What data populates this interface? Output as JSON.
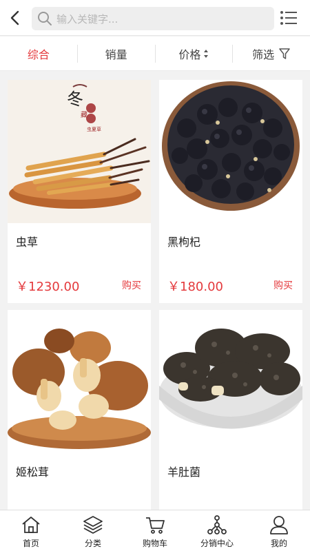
{
  "header": {
    "search_placeholder": "输入关键字..."
  },
  "sort_tabs": [
    {
      "label": "综合",
      "active": true
    },
    {
      "label": "销量",
      "active": false
    },
    {
      "label": "价格",
      "active": false
    },
    {
      "label": "筛选",
      "active": false
    }
  ],
  "products": [
    {
      "name": "虫草",
      "price": "￥1230.00",
      "buy_label": "购买",
      "image_text": {
        "main": "冬",
        "sub": "藏",
        "seal": "虫夏草"
      }
    },
    {
      "name": "黑枸杞",
      "price": "￥180.00",
      "buy_label": "购买"
    },
    {
      "name": "姬松茸",
      "price": "",
      "buy_label": ""
    },
    {
      "name": "羊肚菌",
      "price": "",
      "buy_label": ""
    }
  ],
  "tabbar": [
    {
      "label": "首页",
      "icon": "home-icon"
    },
    {
      "label": "分类",
      "icon": "layers-icon"
    },
    {
      "label": "购物车",
      "icon": "cart-icon"
    },
    {
      "label": "分销中心",
      "icon": "network-icon"
    },
    {
      "label": "我的",
      "icon": "user-icon"
    }
  ],
  "colors": {
    "accent": "#e4393c",
    "background": "#f2f2f2"
  }
}
